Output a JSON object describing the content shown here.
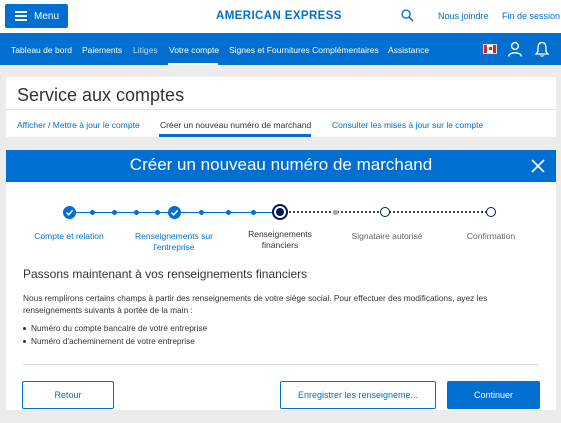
{
  "header": {
    "menu_label": "Menu",
    "brand": "AMERICAN EXPRESS",
    "contact_label": "Nous joindre",
    "logout_label": "Fin de session"
  },
  "nav": {
    "items": [
      {
        "label": "Tableau de bord"
      },
      {
        "label": "Paiements"
      },
      {
        "label": "Litiges"
      },
      {
        "label": "Votre compte"
      },
      {
        "label": "Signes et Fournitures Complémentaires"
      },
      {
        "label": "Assistance"
      }
    ],
    "active": "Votre compte"
  },
  "service": {
    "title": "Service aux comptes",
    "tabs": [
      {
        "label": "Afficher / Mettre à jour le compte"
      },
      {
        "label": "Créer un nouveau numéro de marchand"
      },
      {
        "label": "Consulter les mises à jour sur le compte"
      }
    ],
    "active_tab": "Créer un nouveau numéro de marchand"
  },
  "modal": {
    "title": "Créer un nouveau numéro de marchand",
    "steps": [
      {
        "label_1": "Compte et relation",
        "label_2": "",
        "state": "complete"
      },
      {
        "label_1": "Renseignements sur",
        "label_2": "l'entreprise",
        "state": "complete"
      },
      {
        "label_1": "Renseignements",
        "label_2": "financiers",
        "state": "current"
      },
      {
        "label_1": "Signataire autorisé",
        "label_2": "",
        "state": "pending"
      },
      {
        "label_1": "Confirmation",
        "label_2": "",
        "state": "pending"
      }
    ],
    "heading": "Passons maintenant à vos renseignements financiers",
    "paragraph": "Nous remplirons certains champs à partir des renseignements de votre siège social. Pour effectuer des modifications, ayez les renseignements suivants à portée de la main :",
    "bullets": [
      "Numéro du compte bancaire de votre entreprise",
      "Numéro d'acheminement de votre entreprise"
    ],
    "buttons": {
      "back": "Retour",
      "save": "Enregistrer les renseigneme...",
      "continue": "Continuer"
    }
  },
  "colors": {
    "brand_blue": "#006fcf",
    "navy": "#00175a",
    "background": "#ececec"
  }
}
